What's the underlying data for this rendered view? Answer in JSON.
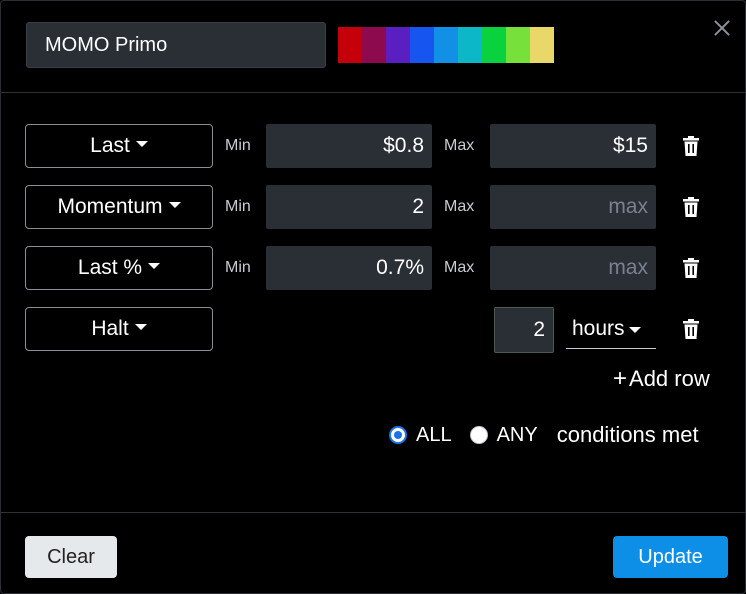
{
  "header": {
    "name_value": "MOMO Primo",
    "swatches": [
      "#c4000b",
      "#8e0a4f",
      "#5a1fc0",
      "#1755f0",
      "#1290e6",
      "#0cb7c8",
      "#09d23e",
      "#78e03a",
      "#e8d86a"
    ]
  },
  "close_icon": "close-icon",
  "rows": [
    {
      "field": "Last",
      "min_label": "Min",
      "min_value": "$0.8",
      "max_label": "Max",
      "max_value": "$15",
      "max_placeholder": "max"
    },
    {
      "field": "Momentum",
      "min_label": "Min",
      "min_value": "2",
      "max_label": "Max",
      "max_value": "",
      "max_placeholder": "max"
    },
    {
      "field": "Last %",
      "min_label": "Min",
      "min_value": "0.7%",
      "max_label": "Max",
      "max_value": "",
      "max_placeholder": "max"
    },
    {
      "field": "Halt",
      "amount": "2",
      "unit": "hours"
    }
  ],
  "add_row": {
    "plus": "+",
    "label": "Add row"
  },
  "conditions": {
    "all_label": "ALL",
    "any_label": "ANY",
    "suffix": "conditions met",
    "selected": "ALL"
  },
  "footer": {
    "clear_label": "Clear",
    "update_label": "Update"
  }
}
